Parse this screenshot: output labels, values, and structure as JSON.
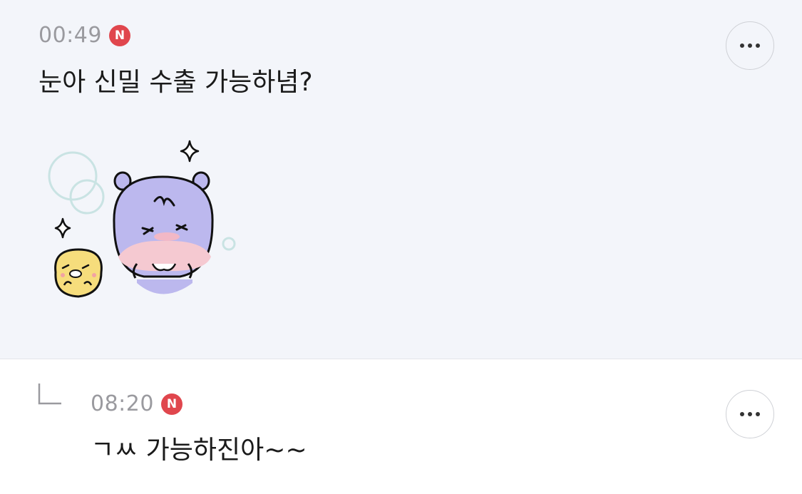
{
  "comment": {
    "time": "00:49",
    "new_badge": "N",
    "text": "눈아 신밀 수출 가능하념?",
    "more_icon": "ellipsis-icon",
    "sticker": "cute-sticker-image"
  },
  "reply": {
    "time": "08:20",
    "new_badge": "N",
    "text": "ㄱㅆ 가능하진아~~",
    "more_icon": "ellipsis-icon",
    "indent_icon": "reply-arrow-icon"
  },
  "colors": {
    "badge": "#e0464d",
    "time": "#9a9a9f",
    "comment_bg": "#f3f5fa"
  }
}
